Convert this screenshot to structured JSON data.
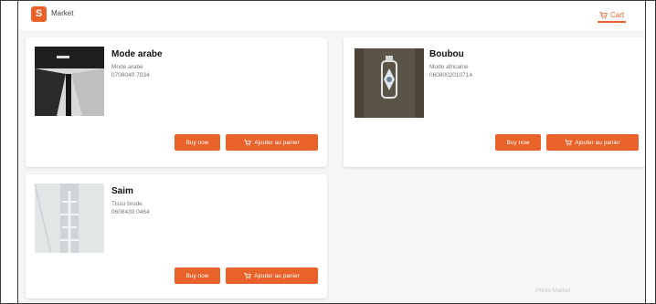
{
  "header": {
    "brand": "Market",
    "logo_letter": "S",
    "cart_label": "Cart"
  },
  "products": [
    {
      "title": "Mode arabe",
      "category": "Mode arabe",
      "phone": "0708040 7034"
    },
    {
      "title": "Boubou",
      "category": "Mode africaine",
      "phone": "0608002010714"
    },
    {
      "title": "Saim",
      "category": "Tissu brode",
      "phone": "0608430 0464"
    }
  ],
  "buttons": {
    "buy_now": "Buy now",
    "add_to_cart": "Ajouter au panier"
  },
  "watermark": "Photo Market",
  "icons": [
    "logo-icon",
    "cart-icon",
    "cart-icon"
  ],
  "colors": {
    "accent": "#e8622a",
    "background": "#f6f6f6",
    "card": "#ffffff"
  }
}
